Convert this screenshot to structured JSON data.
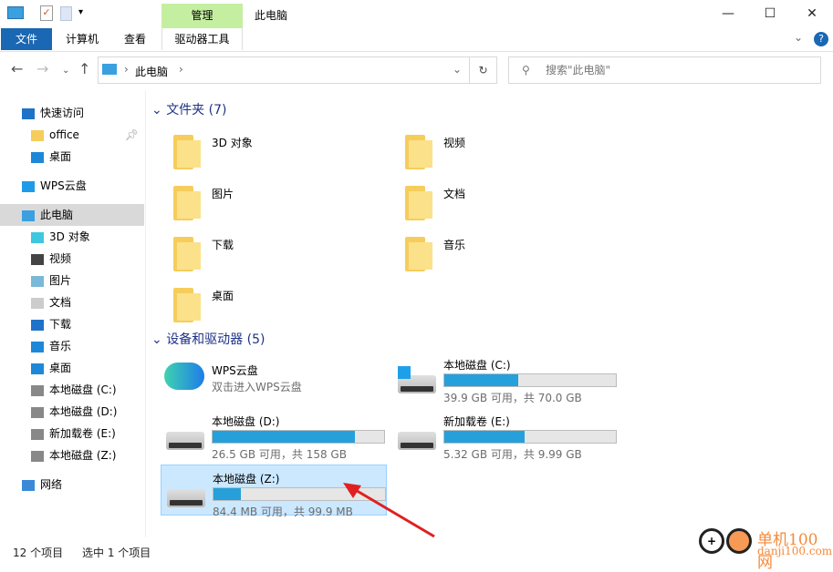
{
  "window": {
    "title": "此电脑",
    "context_tab": "管理",
    "minimize": "—",
    "maximize": "☐",
    "close": "✕"
  },
  "ribbon": {
    "tabs": [
      "文件",
      "计算机",
      "查看",
      "驱动器工具"
    ],
    "collapse": "⌄",
    "help": "?"
  },
  "address": {
    "path": [
      "此电脑"
    ],
    "search_placeholder": "搜索\"此电脑\""
  },
  "sidebar": {
    "items": [
      {
        "label": "快速访问",
        "icon": "star-icon",
        "level": 0
      },
      {
        "label": "office",
        "icon": "folder-icon",
        "level": 1,
        "pinned": true
      },
      {
        "label": "桌面",
        "icon": "desktop-icon",
        "level": 1
      },
      {
        "label": "WPS云盘",
        "icon": "cloud-icon",
        "level": 0
      },
      {
        "label": "此电脑",
        "icon": "computer-icon",
        "level": 0,
        "selected": true
      },
      {
        "label": "3D 对象",
        "icon": "cube-icon",
        "level": 1
      },
      {
        "label": "视频",
        "icon": "video-icon",
        "level": 1
      },
      {
        "label": "图片",
        "icon": "picture-icon",
        "level": 1
      },
      {
        "label": "文档",
        "icon": "document-icon",
        "level": 1
      },
      {
        "label": "下载",
        "icon": "download-icon",
        "level": 1
      },
      {
        "label": "音乐",
        "icon": "music-icon",
        "level": 1
      },
      {
        "label": "桌面",
        "icon": "desktop-icon",
        "level": 1
      },
      {
        "label": "本地磁盘 (C:)",
        "icon": "drive-icon",
        "level": 1
      },
      {
        "label": "本地磁盘 (D:)",
        "icon": "drive-icon",
        "level": 1
      },
      {
        "label": "新加载卷 (E:)",
        "icon": "drive-icon",
        "level": 1
      },
      {
        "label": "本地磁盘 (Z:)",
        "icon": "drive-icon",
        "level": 1
      },
      {
        "label": "网络",
        "icon": "network-icon",
        "level": 0
      }
    ]
  },
  "folders": {
    "header": "文件夹 (7)",
    "items": [
      "3D 对象",
      "视频",
      "图片",
      "文档",
      "下载",
      "音乐",
      "桌面"
    ]
  },
  "devices": {
    "header": "设备和驱动器 (5)",
    "wps": {
      "name": "WPS云盘",
      "subtitle": "双击进入WPS云盘"
    },
    "drives": [
      {
        "name": "本地磁盘 (C:)",
        "info": "39.9 GB 可用，共 70.0 GB",
        "used_percent": 43
      },
      {
        "name": "本地磁盘 (D:)",
        "info": "26.5 GB 可用，共 158 GB",
        "used_percent": 83
      },
      {
        "name": "新加载卷 (E:)",
        "info": "5.32 GB 可用，共 9.99 GB",
        "used_percent": 47
      },
      {
        "name": "本地磁盘 (Z:)",
        "info": "84.4 MB 可用，共 99.9 MB",
        "used_percent": 16,
        "selected": true
      }
    ]
  },
  "status": {
    "count": "12 个项目",
    "selection": "选中 1 个项目"
  },
  "watermark": {
    "text": "单机100网",
    "url_text": "danji100.com"
  },
  "colors": {
    "accent": "#1a67b3",
    "bar": "#26a0da",
    "context": "#c4efa1",
    "selection": "#cce8ff"
  }
}
